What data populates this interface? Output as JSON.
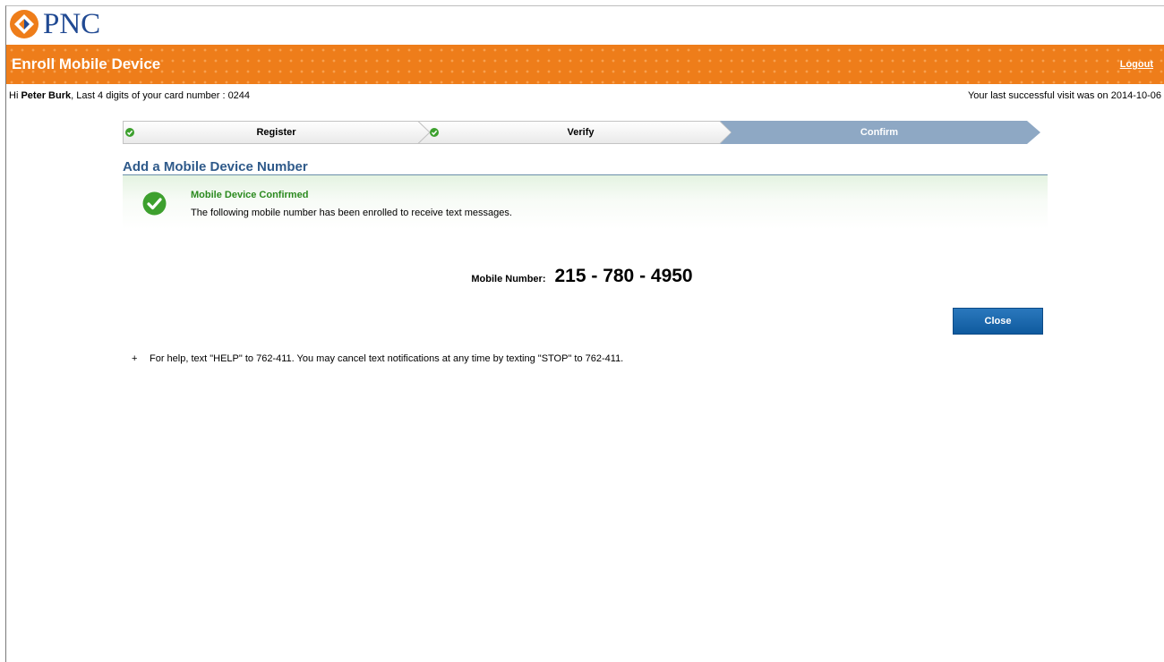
{
  "brand": {
    "name": "PNC",
    "logo_color": "#214a93",
    "accent_color": "#ee7d1a"
  },
  "header": {
    "title": "Enroll Mobile Device",
    "logout_label": "Logout"
  },
  "user": {
    "greeting_prefix": "Hi ",
    "name": "Peter Burk",
    "card_text": ", Last 4 digits of your card number : 0244",
    "last_visit": "Your last successful visit was on 2014-10-06"
  },
  "steps": [
    {
      "label": "Register",
      "status": "complete"
    },
    {
      "label": "Verify",
      "status": "complete"
    },
    {
      "label": "Confirm",
      "status": "current"
    }
  ],
  "section": {
    "title": "Add a Mobile Device Number"
  },
  "confirmation": {
    "heading": "Mobile Device Confirmed",
    "message": "The following mobile number has been enrolled to receive text messages."
  },
  "mobile": {
    "label": "Mobile Number:",
    "value": "215 - 780 - 4950"
  },
  "actions": {
    "close_label": "Close"
  },
  "help": {
    "bullet": "+",
    "text": "For help, text \"HELP\" to 762-411. You may cancel text notifications at any time by texting \"STOP\" to 762-411."
  }
}
